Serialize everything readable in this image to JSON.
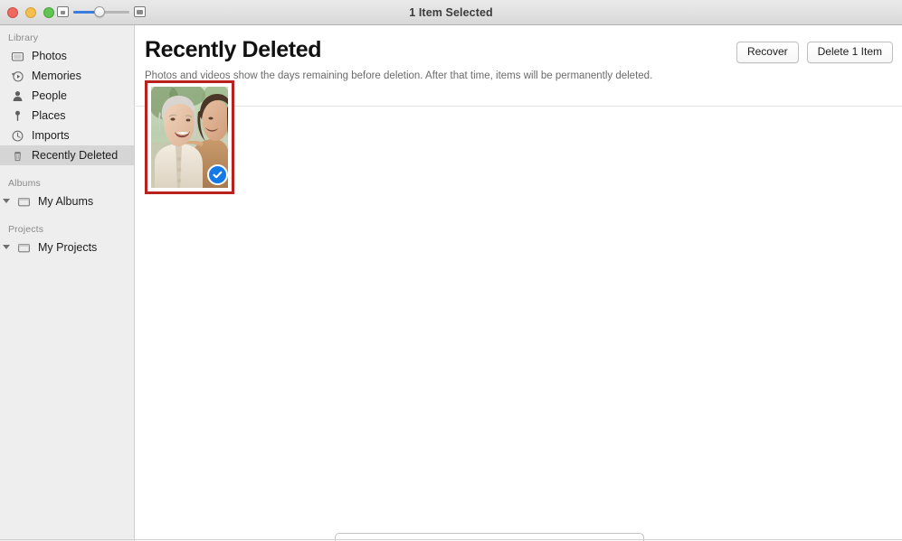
{
  "window": {
    "title": "1 Item Selected",
    "traffic_lights": [
      "close",
      "minimize",
      "maximize"
    ],
    "zoom_slider": {
      "small_icon": "small-thumbnail-icon",
      "large_icon": "large-thumbnail-icon",
      "value": 45
    }
  },
  "sidebar": {
    "sections": [
      {
        "title": "Library",
        "items": [
          {
            "label": "Photos",
            "icon": "photos-icon",
            "selected": false
          },
          {
            "label": "Memories",
            "icon": "memories-icon",
            "selected": false
          },
          {
            "label": "People",
            "icon": "people-icon",
            "selected": false
          },
          {
            "label": "Places",
            "icon": "places-pin-icon",
            "selected": false
          },
          {
            "label": "Imports",
            "icon": "imports-clock-icon",
            "selected": false
          },
          {
            "label": "Recently Deleted",
            "icon": "trash-icon",
            "selected": true
          }
        ]
      },
      {
        "title": "Albums",
        "items": [
          {
            "label": "My Albums",
            "icon": "folder-icon",
            "selected": false,
            "disclosure": "expanded"
          }
        ]
      },
      {
        "title": "Projects",
        "items": [
          {
            "label": "My Projects",
            "icon": "folder-icon",
            "selected": false,
            "disclosure": "expanded"
          }
        ]
      }
    ]
  },
  "main": {
    "title": "Recently Deleted",
    "subtitle": "Photos and videos show the days remaining before deletion. After that time, items will be permanently deleted.",
    "buttons": {
      "recover": "Recover",
      "delete": "Delete 1 Item"
    },
    "grid": {
      "items": [
        {
          "alt": "Elderly woman in cream cardigan laughing with a younger woman outdoors",
          "selected": true,
          "badge": "check-icon",
          "annotation_color": "#b9211f"
        }
      ]
    }
  },
  "colors": {
    "accent_blue": "#1479e8",
    "slider_blue": "#3b7ddd",
    "annotation_red": "#b9211f",
    "sidebar_bg": "#eeeeee",
    "sidebar_selected": "#d5d5d5",
    "toolbar_top": "#e9e9e9",
    "toolbar_bottom": "#d8d8d8",
    "content_bg": "#ffffff"
  }
}
